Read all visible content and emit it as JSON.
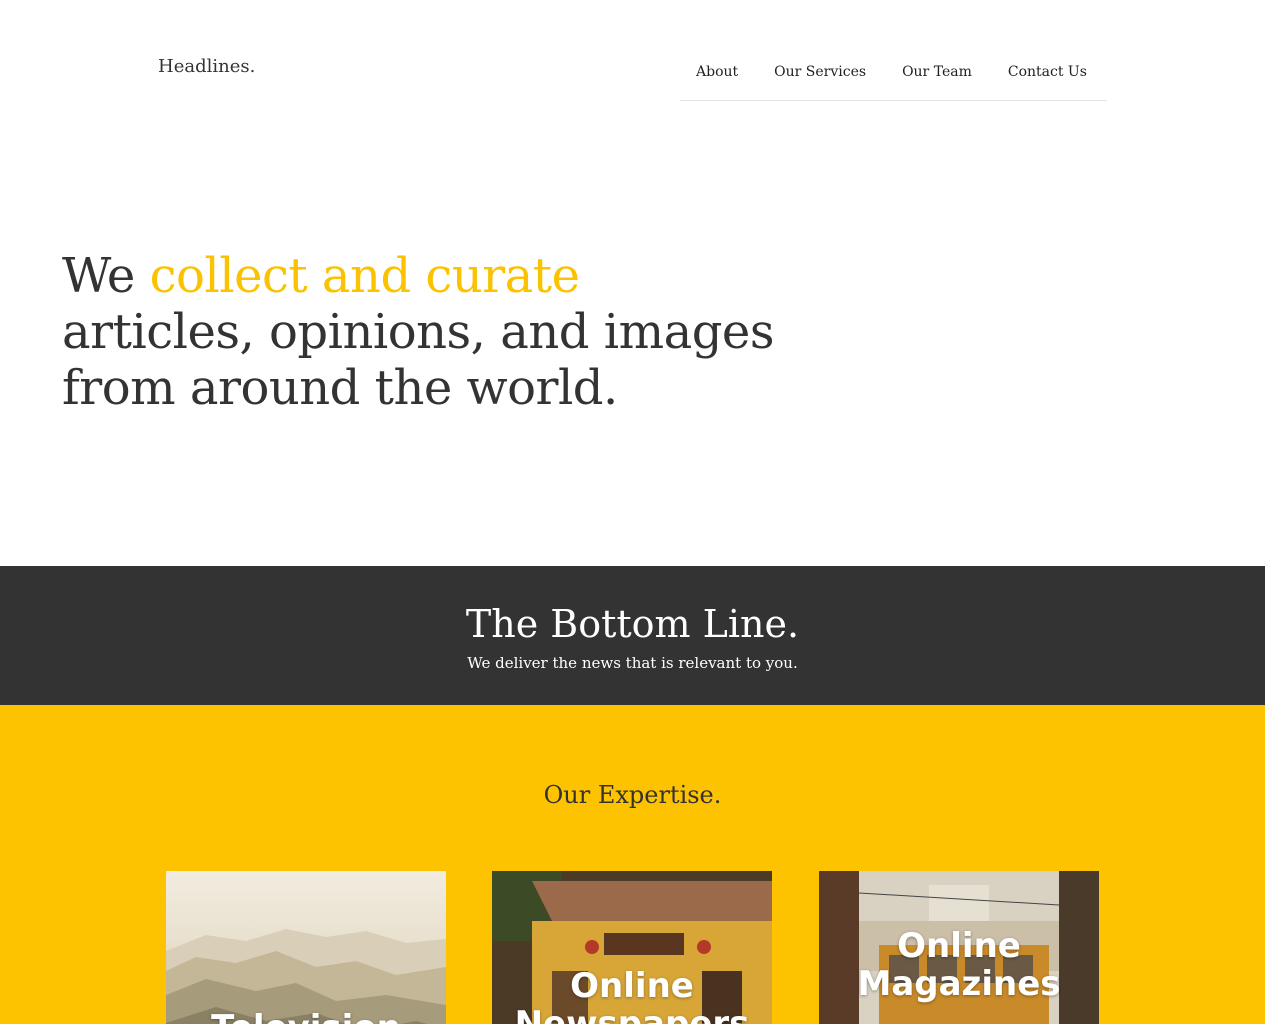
{
  "header": {
    "logo": "Headlines.",
    "nav": {
      "about": "About",
      "services": "Our Services",
      "team": "Our Team",
      "contact": "Contact Us"
    }
  },
  "hero": {
    "line1_prefix": "We ",
    "line1_accent": "collect and curate",
    "line2": "articles, opinions, and images",
    "line3": "from around the world."
  },
  "bottom_line": {
    "title": "The Bottom Line.",
    "subtitle": "We deliver the news that is relevant to you."
  },
  "expertise": {
    "title": "Our Expertise.",
    "cards": [
      {
        "label_line1": "Television",
        "label_line2": ""
      },
      {
        "label_line1": "Online",
        "label_line2": "Newspapers"
      },
      {
        "label_line1": "Online",
        "label_line2": "Magazines"
      }
    ]
  },
  "colors": {
    "accent": "#fbc200",
    "dark_band": "#333333",
    "yellow_section": "#fdc200",
    "text": "#333333"
  }
}
